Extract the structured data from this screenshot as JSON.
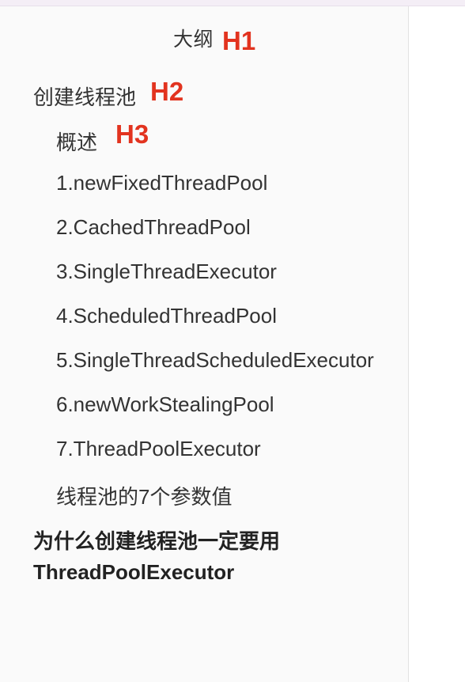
{
  "outline": {
    "title": "大纲",
    "annotations": {
      "h1": "H1",
      "h2": "H2",
      "h3": "H3"
    },
    "items": [
      {
        "level": "h2",
        "label": "创建线程池"
      },
      {
        "level": "h3",
        "label": "概述"
      },
      {
        "level": "h3",
        "label": "1.newFixedThreadPool"
      },
      {
        "level": "h3",
        "label": "2.CachedThreadPool"
      },
      {
        "level": "h3",
        "label": "3.SingleThreadExecutor"
      },
      {
        "level": "h3",
        "label": "4.ScheduledThreadPool"
      },
      {
        "level": "h3",
        "label": "5.SingleThreadScheduledExecutor"
      },
      {
        "level": "h3",
        "label": "6.newWorkStealingPool"
      },
      {
        "level": "h3",
        "label": "7.ThreadPoolExecutor"
      },
      {
        "level": "h3",
        "label": "线程池的7个参数值"
      },
      {
        "level": "h2",
        "label_line1": "为什么创建线程池一定要用",
        "label_line2": "ThreadPoolExecutor"
      }
    ]
  },
  "colors": {
    "annotation": "#e2331f",
    "text": "#333333",
    "sidebar_bg": "#fafafa"
  }
}
